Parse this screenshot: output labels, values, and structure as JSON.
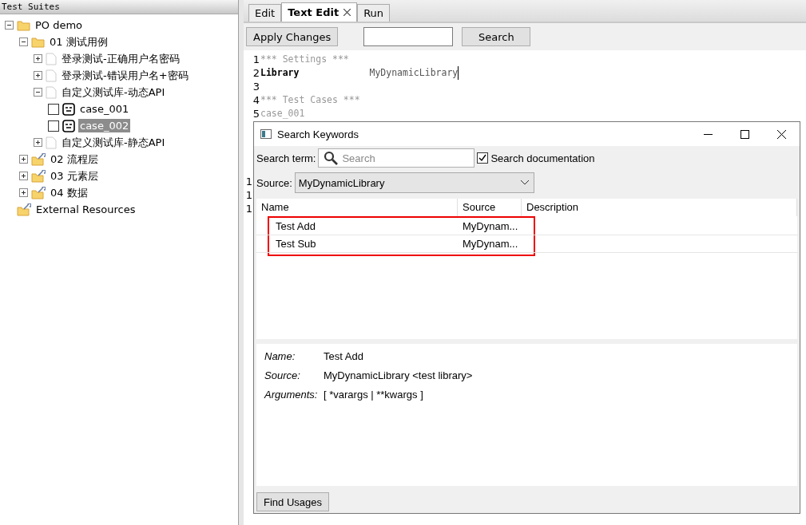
{
  "left_panel": {
    "title": "Test Suites",
    "tree": [
      {
        "label": "PO demo",
        "kind": "folder",
        "expanded": true,
        "selected": false,
        "children": [
          {
            "label": "01 测试用例",
            "kind": "folder",
            "expanded": true,
            "selected": false,
            "children": [
              {
                "label": "登录测试-正确用户名密码",
                "kind": "file",
                "expanded": false,
                "selected": false
              },
              {
                "label": "登录测试-错误用户名+密码",
                "kind": "file",
                "expanded": false,
                "selected": false
              },
              {
                "label": "自定义测试库-动态API",
                "kind": "file",
                "expanded": true,
                "selected": false,
                "children": [
                  {
                    "label": "case_001",
                    "kind": "test",
                    "checked": false,
                    "selected": false
                  },
                  {
                    "label": "case_002",
                    "kind": "test",
                    "checked": false,
                    "selected": true
                  }
                ]
              },
              {
                "label": "自定义测试库-静态API",
                "kind": "file",
                "expanded": false,
                "selected": false
              }
            ]
          },
          {
            "label": "02 流程层",
            "kind": "resource-folder",
            "expanded": false,
            "selected": false
          },
          {
            "label": "03 元素层",
            "kind": "resource-folder",
            "expanded": false,
            "selected": false
          },
          {
            "label": "04 数据",
            "kind": "resource-folder",
            "expanded": false,
            "selected": false
          }
        ]
      },
      {
        "label": "External Resources",
        "kind": "resource-folder",
        "selected": false
      }
    ]
  },
  "tabs": [
    {
      "label": "Edit",
      "selected": false,
      "closable": false
    },
    {
      "label": "Text Edit",
      "selected": true,
      "closable": true
    },
    {
      "label": "Run",
      "selected": false,
      "closable": false
    }
  ],
  "toolbar": {
    "apply_button": "Apply Changes",
    "search_button": "Search"
  },
  "editor": {
    "lines": [
      {
        "number": "1",
        "text": "*** Settings ***",
        "kind": "header"
      },
      {
        "number": "2",
        "text": "Library",
        "value": "MyDynamicLibrary",
        "kind": "setting"
      },
      {
        "number": "3",
        "kind": "blank"
      },
      {
        "number": "4",
        "text": "*** Test Cases ***",
        "kind": "header"
      },
      {
        "number": "5",
        "text": "case_001",
        "kind": "name"
      }
    ],
    "gutter_fragments": [
      "1",
      "1",
      "1"
    ]
  },
  "dialog": {
    "title": "Search Keywords",
    "search_label": "Search term:",
    "search_placeholder": "Search",
    "search_documentation": {
      "label": "Search documentation",
      "checked": true
    },
    "source_label": "Source:",
    "source_value": "MyDynamicLibrary",
    "table": {
      "columns": [
        "Name",
        "Source",
        "Description"
      ],
      "rows": [
        {
          "name": "Test Add",
          "source": "MyDynam...",
          "selected": false
        },
        {
          "name": "Test Sub",
          "source": "MyDynam...",
          "selected": false
        }
      ]
    },
    "details": [
      {
        "label": "Name:",
        "value": "Test Add"
      },
      {
        "label": "Source:",
        "value": "MyDynamicLibrary <test library>"
      },
      {
        "label": "Arguments:",
        "value": "[ *varargs | **kwargs ]"
      }
    ],
    "find_button": "Find Usages"
  }
}
